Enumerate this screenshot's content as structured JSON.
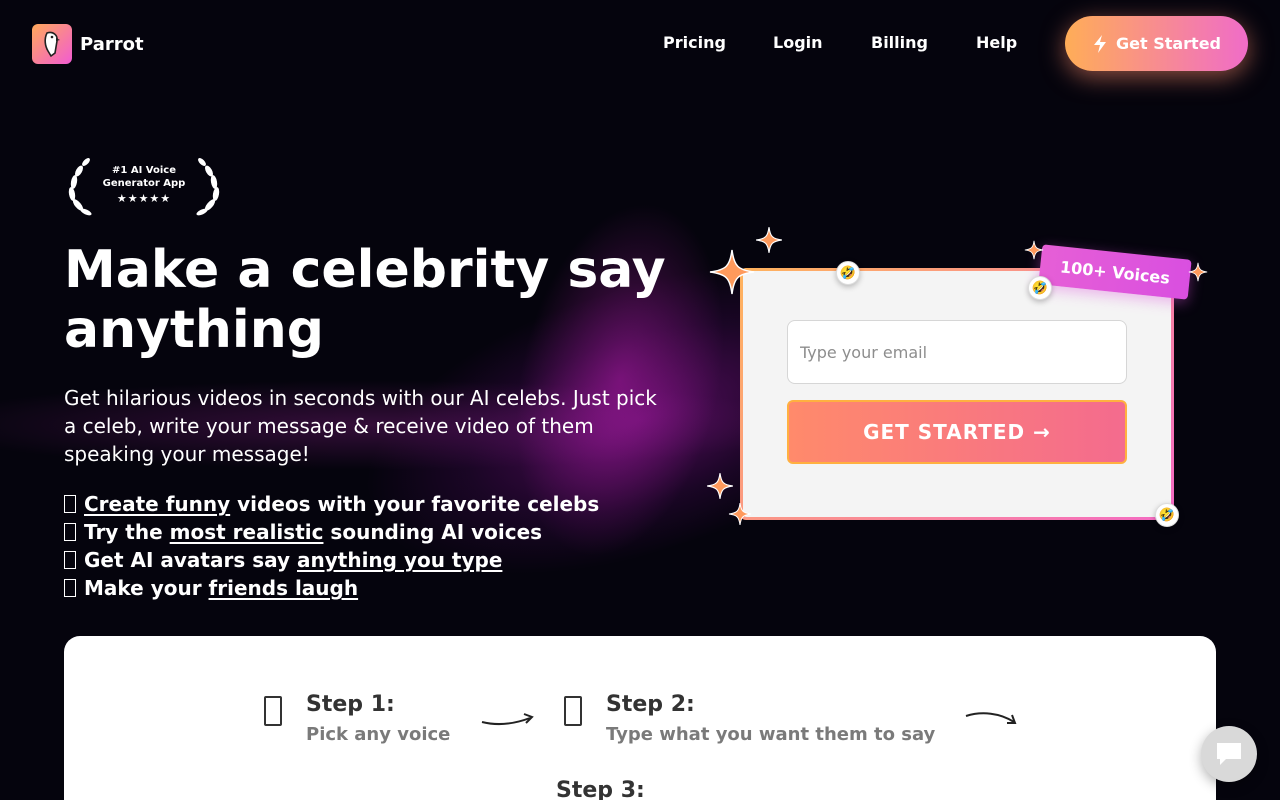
{
  "brand": {
    "name": "Parrot"
  },
  "nav": {
    "items": [
      {
        "label": "Pricing"
      },
      {
        "label": "Login"
      },
      {
        "label": "Billing"
      },
      {
        "label": "Help"
      }
    ],
    "cta_label": "Get Started"
  },
  "award": {
    "line1": "#1 AI Voice",
    "line2": "Generator App",
    "stars": "★★★★★"
  },
  "hero": {
    "title": "Make a celebrity say anything",
    "subtitle": "Get hilarious videos in seconds with our AI celebs. Just pick a celeb, write your message & receive video of them speaking your message!",
    "bullets": [
      {
        "link": "Create funny",
        "rest": " videos with your favorite celebs"
      },
      {
        "pre": "Try the ",
        "link": "most realistic",
        "rest": " sounding AI voices"
      },
      {
        "pre": "Get AI avatars say ",
        "link": "anything you type"
      },
      {
        "pre": "Make your ",
        "link": "friends laugh"
      }
    ]
  },
  "form": {
    "email_placeholder": "Type your email",
    "submit_label": "GET STARTED →",
    "voices_tag": "100+ Voices",
    "emoji": "🤣"
  },
  "steps": [
    {
      "title": "Step 1:",
      "desc": "Pick any voice"
    },
    {
      "title": "Step 2:",
      "desc": "Type what you want them to say"
    },
    {
      "title": "Step 3:",
      "desc": ""
    }
  ],
  "colors": {
    "background": "#05040d",
    "accent_orange": "#ffad57",
    "accent_pink": "#f06cc8",
    "text_gray": "#7a7a7a"
  }
}
